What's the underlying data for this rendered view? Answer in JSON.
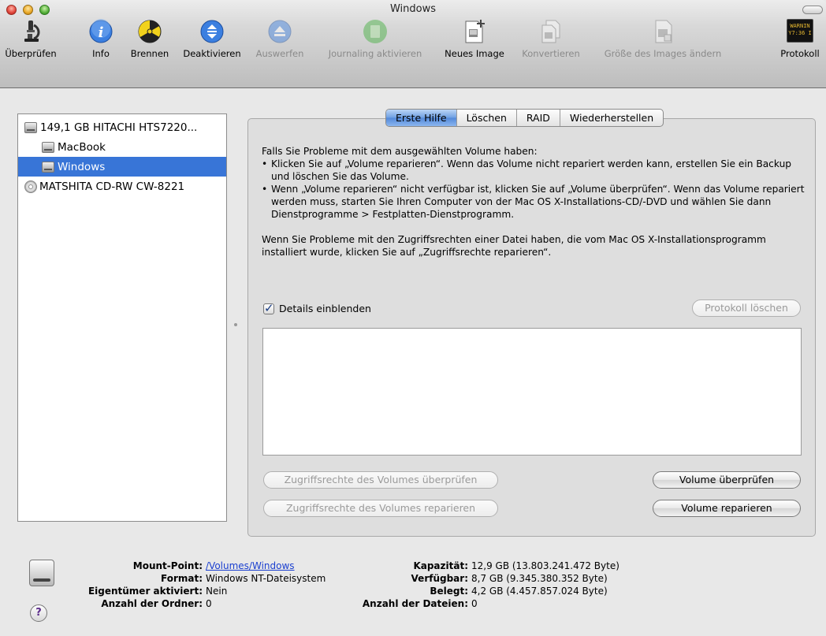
{
  "window": {
    "title": "Windows"
  },
  "toolbar": {
    "items": [
      {
        "label": "Überprüfen",
        "icon": "microscope-icon",
        "enabled": true
      },
      {
        "label": "Info",
        "icon": "info-icon",
        "enabled": true
      },
      {
        "label": "Brennen",
        "icon": "burn-icon",
        "enabled": true
      },
      {
        "label": "Deaktivieren",
        "icon": "unmount-icon",
        "enabled": true
      },
      {
        "label": "Auswerfen",
        "icon": "eject-icon",
        "enabled": false
      },
      {
        "label": "Journaling aktivieren",
        "icon": "journaling-icon",
        "enabled": false
      },
      {
        "label": "Neues Image",
        "icon": "new-image-icon",
        "enabled": true
      },
      {
        "label": "Konvertieren",
        "icon": "convert-icon",
        "enabled": false
      },
      {
        "label": "Größe des Images ändern",
        "icon": "resize-image-icon",
        "enabled": false
      },
      {
        "label": "Protokoll",
        "icon": "log-icon",
        "enabled": true
      }
    ],
    "log_icon_text": "WARNIN\nY7:36 I"
  },
  "sidebar": {
    "items": [
      {
        "label": "149,1 GB HITACHI HTS7220...",
        "type": "disk",
        "selected": false
      },
      {
        "label": "MacBook",
        "type": "volume",
        "selected": false
      },
      {
        "label": "Windows",
        "type": "volume",
        "selected": true
      },
      {
        "label": "MATSHITA CD-RW CW-8221",
        "type": "optical",
        "selected": false
      }
    ]
  },
  "tabs": [
    {
      "label": "Erste Hilfe",
      "active": true
    },
    {
      "label": "Löschen",
      "active": false
    },
    {
      "label": "RAID",
      "active": false
    },
    {
      "label": "Wiederherstellen",
      "active": false
    }
  ],
  "first_aid": {
    "intro": "Falls Sie Probleme mit dem ausgewählten Volume haben:",
    "bullet1": "Klicken Sie auf „Volume reparieren“. Wenn das Volume nicht repariert werden kann, erstellen Sie ein Backup und löschen Sie das Volume.",
    "bullet2": "Wenn „Volume reparieren“ nicht verfügbar ist, klicken Sie auf „Volume überprüfen“. Wenn das Volume repariert werden muss, starten Sie Ihren Computer von der Mac OS X-Installations-CD/-DVD und wählen Sie dann Dienstprogramme > Festplatten-Dienstprogramm.",
    "permissions_note": "Wenn Sie Probleme mit den Zugriffsrechten einer Datei haben, die vom Mac OS X-Installationsprogramm installiert wurde, klicken Sie auf „Zugriffsrechte reparieren“.",
    "details_label": "Details einblenden",
    "details_checked": true,
    "clear_log_label": "Protokoll löschen",
    "verify_permissions_label": "Zugriffsrechte des Volumes überprüfen",
    "repair_permissions_label": "Zugriffsrechte des Volumes reparieren",
    "verify_volume_label": "Volume überprüfen",
    "repair_volume_label": "Volume reparieren"
  },
  "volume_info": {
    "mount_point_key": "Mount-Point:",
    "mount_point": "/Volumes/Windows",
    "format_key": "Format:",
    "format": "Windows NT-Dateisystem",
    "owners_key": "Eigentümer aktiviert:",
    "owners": "Nein",
    "folders_key": "Anzahl der Ordner:",
    "folders": "0",
    "capacity_key": "Kapazität:",
    "capacity": "12,9 GB (13.803.241.472 Byte)",
    "available_key": "Verfügbar:",
    "available": "8,7 GB (9.345.380.352 Byte)",
    "used_key": "Belegt:",
    "used": "4,2 GB (4.457.857.024 Byte)",
    "files_key": "Anzahl der Dateien:",
    "files": "0"
  },
  "help_label": "?"
}
